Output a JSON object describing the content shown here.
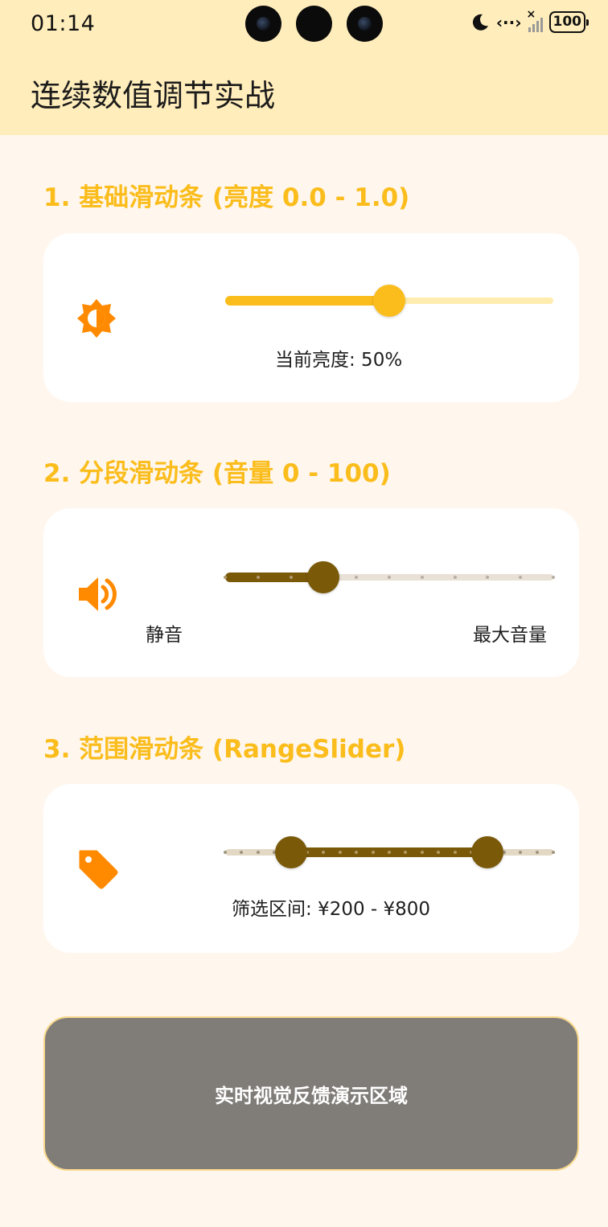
{
  "status_bar": {
    "time": "01:14",
    "network": "‹··›",
    "signal": "×",
    "battery": "100"
  },
  "app_bar": {
    "title": "连续数值调节实战"
  },
  "basic_slider": {
    "title": "1. 基础滑动条 (亮度 0.0 - 1.0)",
    "value": 0.5,
    "caption": "当前亮度: 50%",
    "icon": "brightness-icon",
    "active_color": "#fbbd1c",
    "inactive_color": "#ffedb0"
  },
  "discrete_slider": {
    "title": "2. 分段滑动条 (音量 0 - 100)",
    "value": 30,
    "min": 0,
    "max": 100,
    "divisions": 10,
    "min_label": "静音",
    "max_label": "最大音量",
    "icon": "volume-up-icon",
    "active_color": "#7a5909",
    "inactive_color": "#e9e0d6"
  },
  "range_slider": {
    "title": "3. 范围滑动条 (RangeSlider)",
    "start": 200,
    "end": 800,
    "min": 0,
    "max": 1000,
    "divisions": 20,
    "caption": "筛选区间: ¥200 - ¥800",
    "icon": "price-tag-icon",
    "active_color": "#7a5909",
    "inactive_color": "#e2d8c4"
  },
  "demo_area": {
    "label": "实时视觉反馈演示区域",
    "color": "#807c78"
  }
}
